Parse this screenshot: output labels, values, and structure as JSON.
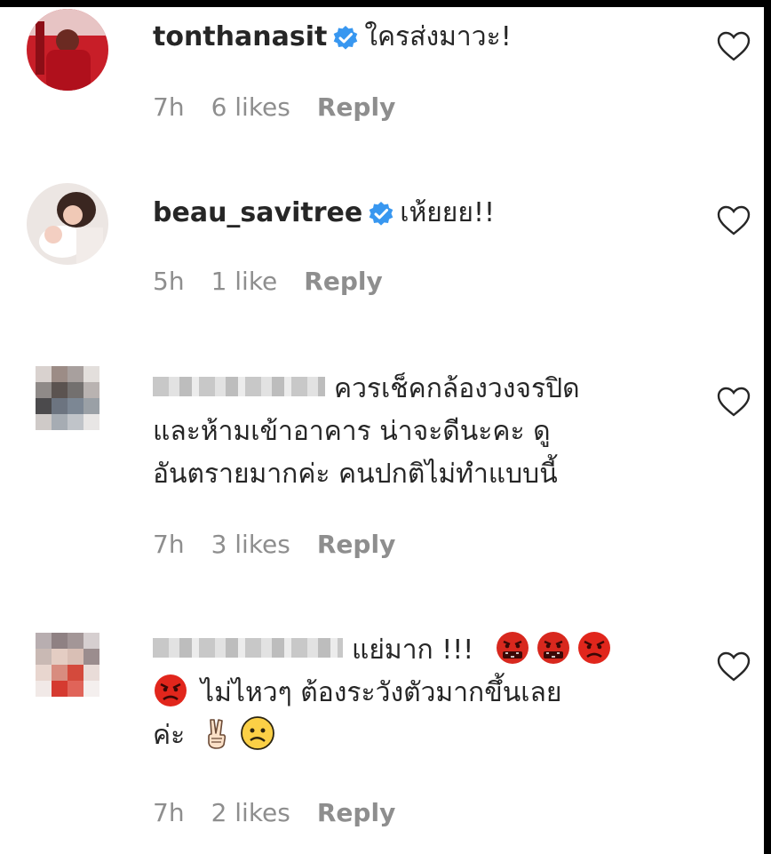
{
  "comments": [
    {
      "username": "tonthanasit",
      "verified": true,
      "text": "ใครส่งมาวะ!",
      "time": "7h",
      "likes": "6 likes",
      "reply": "Reply"
    },
    {
      "username": "beau_savitree",
      "verified": true,
      "text": "เห้ยยย!!",
      "time": "5h",
      "likes": "1 like",
      "reply": "Reply"
    },
    {
      "username": "",
      "verified": false,
      "text_line1": "ควรเช็คกล้องวงจรปิด",
      "text_line2": "และห้ามเข้าอาคาร น่าจะดีนะคะ ดู",
      "text_line3": "อันตรายมากค่ะ คนปกติไม่ทำแบบนี้",
      "time": "7h",
      "likes": "3 likes",
      "reply": "Reply"
    },
    {
      "username": "",
      "verified": false,
      "text_line1": "แย่มาก !!!",
      "text_line2": "ไม่ไหวๆ ต้องระวังตัวมากขึ้นเลย",
      "text_line3": "ค่ะ",
      "emojis_line1": [
        "cursing-face-icon",
        "cursing-face-icon",
        "angry-face-icon"
      ],
      "emojis_line2": [
        "angry-face-icon"
      ],
      "emojis_line3": [
        "victory-hand-icon",
        "confused-face-icon"
      ],
      "time": "7h",
      "likes": "2 likes",
      "reply": "Reply"
    }
  ],
  "colors": {
    "text": "#262626",
    "meta": "#8e8e8e",
    "verified": "#3897f0",
    "background": "#ffffff"
  }
}
